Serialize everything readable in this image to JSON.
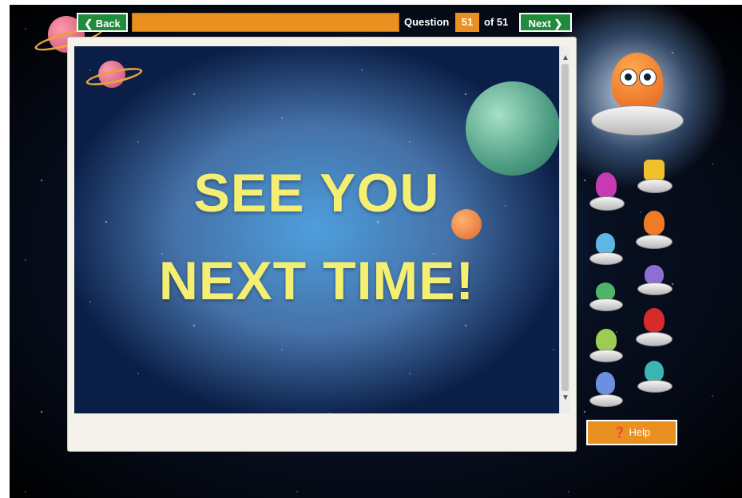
{
  "nav": {
    "back_label": "❮ Back",
    "next_label": "Next ❯",
    "question_label": "Question",
    "current_question": "51",
    "total_label": "of 51",
    "progress_fraction": 1.0
  },
  "slide": {
    "line1": "SEE YOU",
    "line2": "NEXT TIME!"
  },
  "help": {
    "label": "Help",
    "icon": "question-circle-icon"
  },
  "colors": {
    "accent_orange": "#e99020",
    "nav_green": "#1e8c3a",
    "slide_text_yellow": "#f4ef72"
  }
}
